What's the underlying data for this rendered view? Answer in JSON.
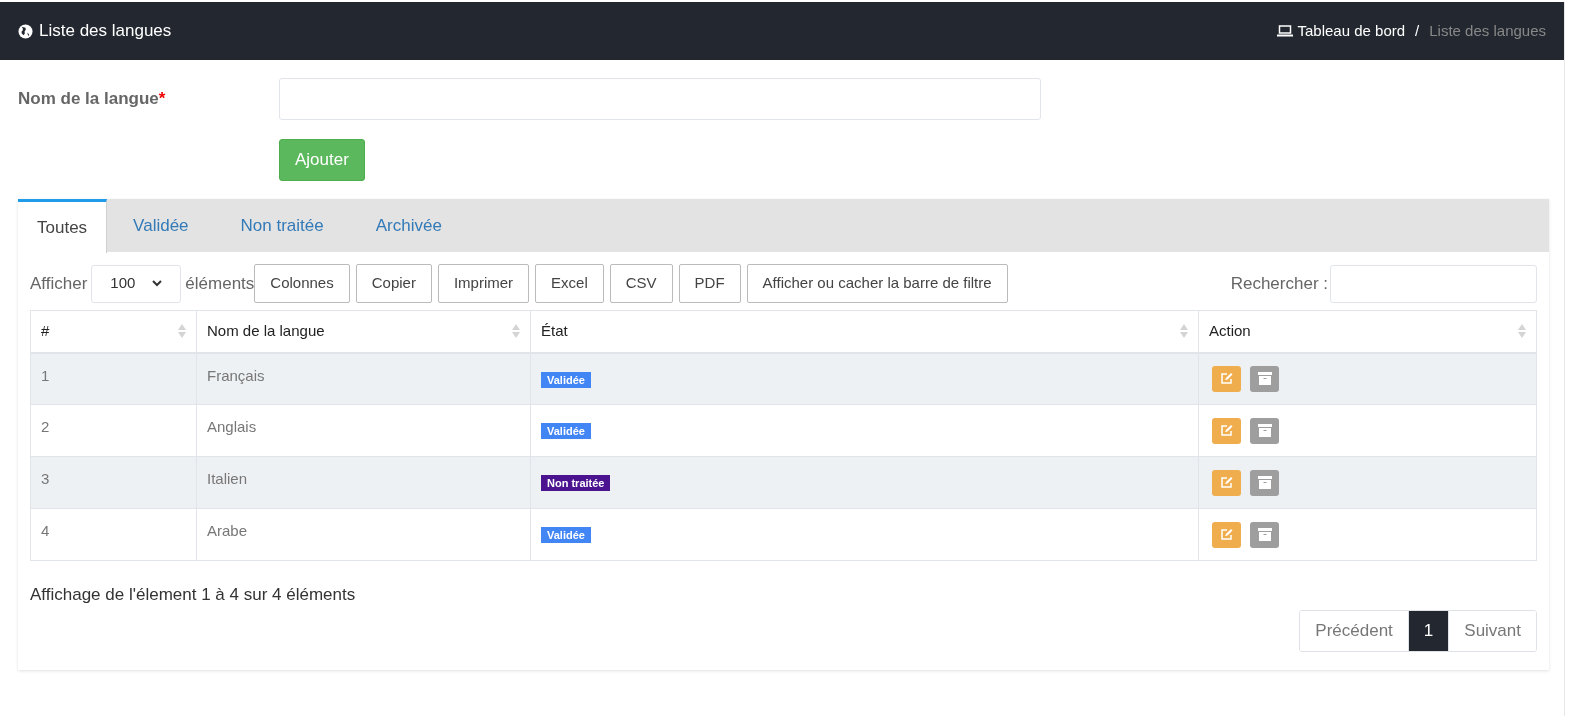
{
  "header": {
    "title": "Liste des langues",
    "breadcrumb": [
      {
        "label": "Tableau de bord",
        "current": false
      },
      {
        "label": "/",
        "current": false
      },
      {
        "label": "Liste des langues",
        "current": true
      }
    ]
  },
  "form": {
    "label": "Nom de la langue",
    "required_mark": "*",
    "submit": "Ajouter"
  },
  "tabs": [
    {
      "label": "Toutes",
      "selected": true
    },
    {
      "label": "Validée",
      "selected": false
    },
    {
      "label": "Non traitée",
      "selected": false
    },
    {
      "label": "Archivée",
      "selected": false
    }
  ],
  "toolbar": {
    "show_label": "Afficher",
    "page_size": "100",
    "show_suffix": "éléments",
    "buttons": [
      "Colonnes",
      "Copier",
      "Imprimer",
      "Excel",
      "CSV",
      "PDF",
      "Afficher ou cacher la barre de filtre"
    ],
    "search_label": "Rechercher :"
  },
  "table": {
    "columns": [
      "#",
      "Nom de la langue",
      "État",
      "Action"
    ],
    "rows": [
      {
        "index": "1",
        "name": "Français",
        "status": "Validée",
        "color": "#4285f4"
      },
      {
        "index": "2",
        "name": "Anglais",
        "status": "Validée",
        "color": "#4285f4"
      },
      {
        "index": "3",
        "name": "Italien",
        "status": "Non traitée",
        "color": "#4b1390"
      },
      {
        "index": "4",
        "name": "Arabe",
        "status": "Validée",
        "color": "#4285f4"
      }
    ]
  },
  "info": "Affichage de l'élement 1 à 4 sur 4 éléments",
  "pagination": [
    {
      "label": "Précédent",
      "selected": false
    },
    {
      "label": "1",
      "selected": true
    },
    {
      "label": "Suivant",
      "selected": false
    }
  ]
}
